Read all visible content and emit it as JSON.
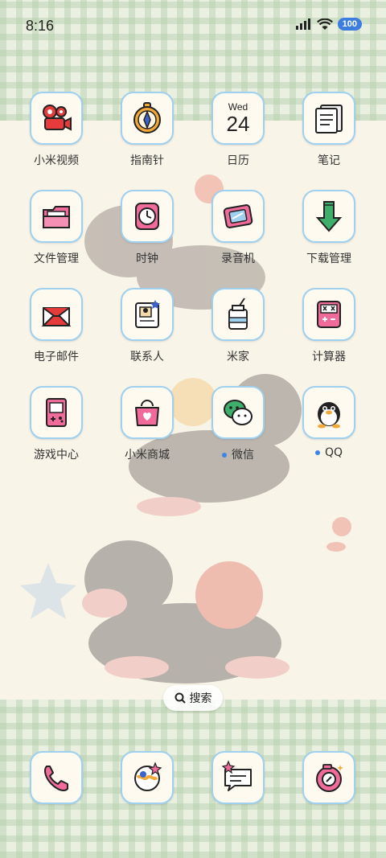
{
  "status_bar": {
    "time": "8:16",
    "battery": "100",
    "icons": [
      "signal-icon",
      "wifi-icon",
      "battery-icon"
    ]
  },
  "apps": [
    {
      "label": "小米视频",
      "icon": "video-icon",
      "notify": false
    },
    {
      "label": "指南针",
      "icon": "compass-icon",
      "notify": false
    },
    {
      "label": "日历",
      "icon": "calendar-icon",
      "notify": false,
      "calendar_day": "Wed",
      "calendar_date": "24"
    },
    {
      "label": "笔记",
      "icon": "notes-icon",
      "notify": false
    },
    {
      "label": "文件管理",
      "icon": "folder-icon",
      "notify": false
    },
    {
      "label": "时钟",
      "icon": "clock-icon",
      "notify": false
    },
    {
      "label": "录音机",
      "icon": "recorder-icon",
      "notify": false
    },
    {
      "label": "下载管理",
      "icon": "download-icon",
      "notify": false
    },
    {
      "label": "电子邮件",
      "icon": "mail-icon",
      "notify": false
    },
    {
      "label": "联系人",
      "icon": "contacts-icon",
      "notify": false
    },
    {
      "label": "米家",
      "icon": "mijia-icon",
      "notify": false
    },
    {
      "label": "计算器",
      "icon": "calculator-icon",
      "notify": false
    },
    {
      "label": "游戏中心",
      "icon": "game-icon",
      "notify": false
    },
    {
      "label": "小米商城",
      "icon": "store-icon",
      "notify": false
    },
    {
      "label": "微信",
      "icon": "wechat-icon",
      "notify": true
    },
    {
      "label": "QQ",
      "icon": "qq-icon",
      "notify": true
    }
  ],
  "search": {
    "label": "搜索",
    "icon": "search-icon"
  },
  "dock": [
    {
      "icon": "phone-icon"
    },
    {
      "icon": "browser-icon"
    },
    {
      "icon": "messages-icon"
    },
    {
      "icon": "camera-icon"
    }
  ],
  "colors": {
    "background": "#f8f4e8",
    "gingham": "#e9f0e0",
    "icon_border": "#9ed0ef",
    "accent_pink": "#f06b9a",
    "accent_blue": "#3c84e6"
  }
}
